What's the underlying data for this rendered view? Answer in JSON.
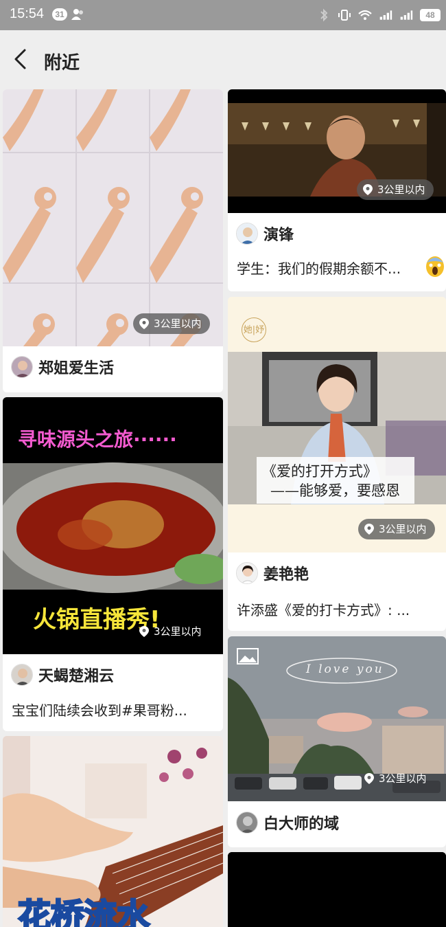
{
  "status_bar": {
    "time": "15:54",
    "notification_count": "31",
    "battery": "48"
  },
  "header": {
    "title": "附近"
  },
  "feed": [
    {
      "distance": "3公里以内",
      "author": "郑姐爱生活",
      "description": ""
    },
    {
      "distance": "3公里以内",
      "author": "演锋",
      "description": "学生：我们的假期余额不..."
    },
    {
      "distance": "3公里以内",
      "author": "天蝎楚湘云",
      "description": "宝宝们陆续会收到#果哥粉...",
      "overlay_top": "寻味源头之旅······",
      "overlay_bottom": "火锅直播秀!"
    },
    {
      "distance": "3公里以内",
      "author": "姜艳艳",
      "description": "许添盛《爱的打卡方式》: ...",
      "overlay_line1": "《爱的打开方式》",
      "overlay_line2": "——能够爱，要感恩",
      "brand": "她|妤"
    },
    {
      "distance": "3公里以内",
      "author": "白大师的域",
      "description": "",
      "overlay_text": "I love you"
    },
    {
      "overlay_text": "花桥流水"
    }
  ]
}
